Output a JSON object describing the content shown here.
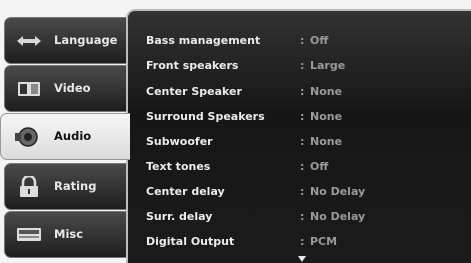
{
  "tabs": [
    {
      "label": "Language",
      "icon": "language-icon",
      "active": false
    },
    {
      "label": "Video",
      "icon": "video-icon",
      "active": false
    },
    {
      "label": "Audio",
      "icon": "speaker-icon",
      "active": true
    },
    {
      "label": "Rating",
      "icon": "lock-icon",
      "active": false
    },
    {
      "label": "Misc",
      "icon": "misc-icon",
      "active": false
    }
  ],
  "settings": [
    {
      "name": "Bass management",
      "sep": ":",
      "value": "Off"
    },
    {
      "name": "Front speakers",
      "sep": ":",
      "value": "Large"
    },
    {
      "name": "Center Speaker",
      "sep": ":",
      "value": "None"
    },
    {
      "name": "Surround Speakers",
      "sep": ":",
      "value": "None"
    },
    {
      "name": "Subwoofer",
      "sep": ":",
      "value": "None"
    },
    {
      "name": "Text tones",
      "sep": ":",
      "value": "Off"
    },
    {
      "name": "Center delay",
      "sep": ":",
      "value": "No Delay"
    },
    {
      "name": "Surr. delay",
      "sep": ":",
      "value": "No Delay"
    },
    {
      "name": "Digital Output",
      "sep": ":",
      "value": "PCM"
    }
  ],
  "colors": {
    "panel_bg": "#1b1b1b",
    "label_text": "#ececec",
    "value_text": "#9a9a9a",
    "active_tab": "#e8e8e8"
  }
}
